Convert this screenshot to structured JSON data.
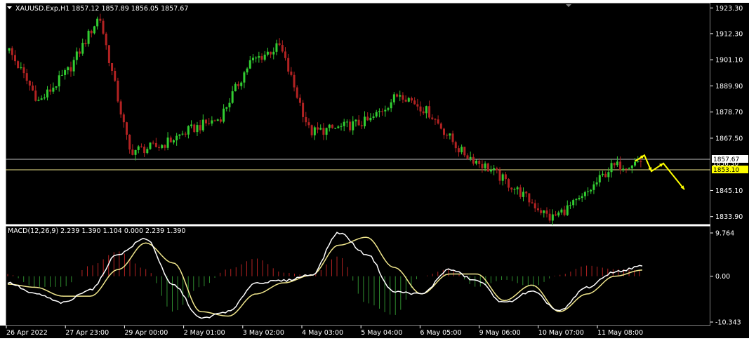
{
  "colors": {
    "background": "#000000",
    "frame": "#ffffff",
    "bull_candle": "#32cd32",
    "bear_candle": "#b22222",
    "text": "#ffffff",
    "bid_line": "#c0c0c0",
    "level_line": "#f0e68c",
    "level_tag": "#ffff00",
    "arrows": "#ffff00",
    "macd_line": "#ffffff",
    "signal_line": "#f0e68c",
    "hist_pos": "#b22222",
    "hist_neg": "#2e8b2e"
  },
  "main_chart": {
    "title": "XAUUSD.Exp,H1  1857.12 1857.89 1856.05 1857.67",
    "price_labels": [
      "1923.30",
      "1912.30",
      "1901.10",
      "1889.90",
      "1878.70",
      "1867.50",
      "1845.10",
      "1833.90"
    ],
    "current_price_tag": "1857.67",
    "level_tag": "1853.10",
    "hidden_tag": "1856.30"
  },
  "macd_panel": {
    "title": "MACD(12,26,9) 2.239 1.390 1.104 0.000 2.239 1.390",
    "labels": [
      "9.764",
      "0.00",
      "-10.343"
    ]
  },
  "time_axis": {
    "labels": [
      "26 Apr 2022",
      "27 Apr 23:00",
      "29 Apr 00:00",
      "2 May 01:00",
      "3 May 02:00",
      "4 May 03:00",
      "5 May 04:00",
      "6 May 05:00",
      "9 May 06:00",
      "10 May 07:00",
      "11 May 08:00"
    ]
  },
  "chart_data": {
    "type": "line",
    "title": "XAUUSD.Exp,H1",
    "ylim": [
      1830.5,
      1925.5
    ],
    "x": [
      "26 Apr 2022",
      "27 Apr 23:00",
      "29 Apr 00:00",
      "2 May 01:00",
      "3 May 02:00",
      "4 May 03:00",
      "5 May 04:00",
      "6 May 05:00",
      "9 May 06:00",
      "10 May 07:00",
      "11 May 08:00"
    ],
    "series": [
      {
        "values": [
          1905,
          1883,
          1897,
          1920,
          1862,
          1864,
          1871,
          1876,
          1900,
          1907,
          1870,
          1872,
          1875,
          1887,
          1878,
          1862,
          1854,
          1844,
          1833,
          1841,
          1855,
          1857.67
        ]
      }
    ],
    "levels": [
      1857.67,
      1853.1
    ],
    "projection": [
      1857.67,
      1860.2,
      1853.3,
      1856.7,
      1845.5
    ],
    "macd": {
      "ylim": [
        -10.343,
        9.764
      ],
      "macd_values": [
        -1.5,
        -4,
        -6,
        -3,
        5,
        8.5,
        -2,
        -9.5,
        -8,
        -1.5,
        -1,
        0.3,
        9.8,
        5,
        -3.5,
        -4,
        1.5,
        -1,
        -6,
        -3.5,
        -7.8,
        -2.5,
        1,
        2.239
      ],
      "signal_values": [
        -1.8,
        -2.5,
        -4.5,
        -4.5,
        1.5,
        7.5,
        3,
        -8,
        -9,
        -4,
        -1.5,
        0.2,
        7,
        8.8,
        2,
        -4,
        0.5,
        0.5,
        -5.5,
        -2,
        -8,
        -4,
        0,
        1.39
      ]
    }
  }
}
